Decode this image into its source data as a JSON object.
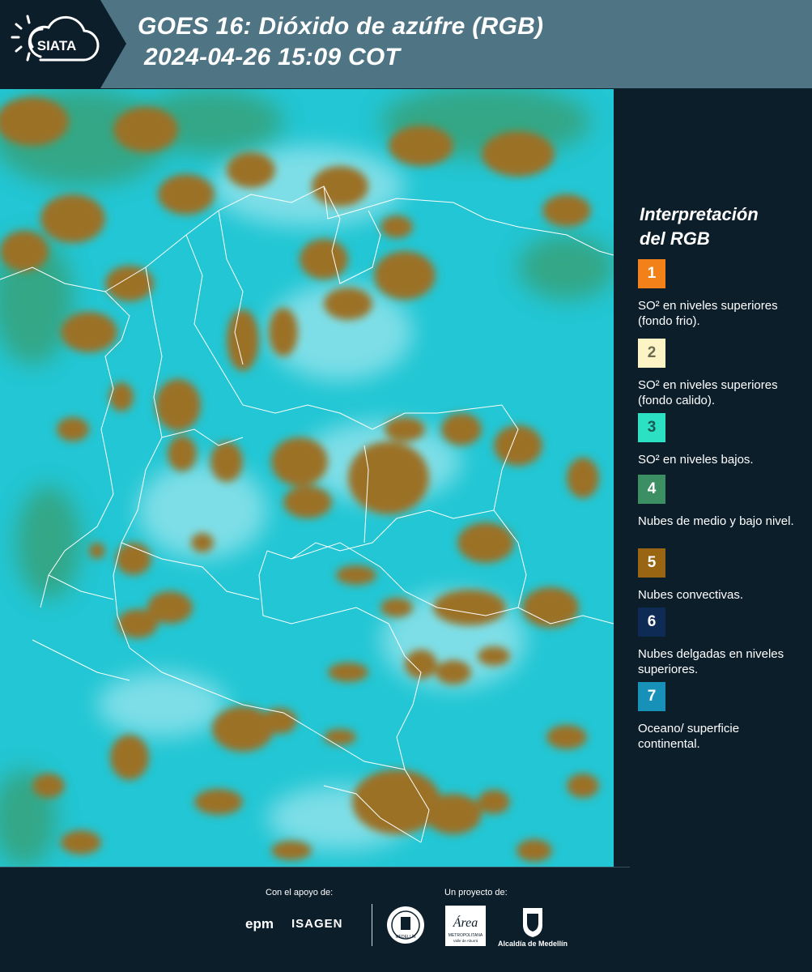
{
  "header": {
    "logo_text": "SIATA",
    "title_line1": "GOES 16: Dióxido de azúfre (RGB)",
    "title_line2": "2024-04-26 15:09 COT"
  },
  "map": {
    "background_color": "#22c6d4",
    "cloud_color": "#9b7126",
    "border_color": "#ffffff"
  },
  "legend": {
    "title_line1": "Interpretación",
    "title_line2": "del RGB",
    "items": [
      {
        "number": "1",
        "color": "#f2811a",
        "text": "SO² en niveles superiores (fondo frio)."
      },
      {
        "number": "2",
        "color": "#fdf4c6",
        "text": "SO² en niveles superiores (fondo calido)."
      },
      {
        "number": "3",
        "color": "#2ce0c4",
        "text": "SO² en niveles bajos."
      },
      {
        "number": "4",
        "color": "#3c8f63",
        "text": "Nubes de medio y bajo nivel."
      },
      {
        "number": "5",
        "color": "#9a6513",
        "text": "Nubes convectivas."
      },
      {
        "number": "6",
        "color": "#0e2b56",
        "text": "Nubes delgadas en niveles superiores."
      },
      {
        "number": "7",
        "color": "#1791b8",
        "text": "Oceano/ superficie continental."
      }
    ]
  },
  "footer": {
    "support_label": "Con el apoyo de:",
    "project_label": "Un proyecto de:",
    "sponsor1": "epm",
    "sponsor2": "ISAGEN",
    "partner_area": "Área",
    "partner_area_sub": "METROPOLITANA",
    "partner_area_sub2": "Valle de Aburrá",
    "partner_alcaldia": "Alcaldía de Medellín",
    "seal_text": "MEDELLÍN"
  }
}
